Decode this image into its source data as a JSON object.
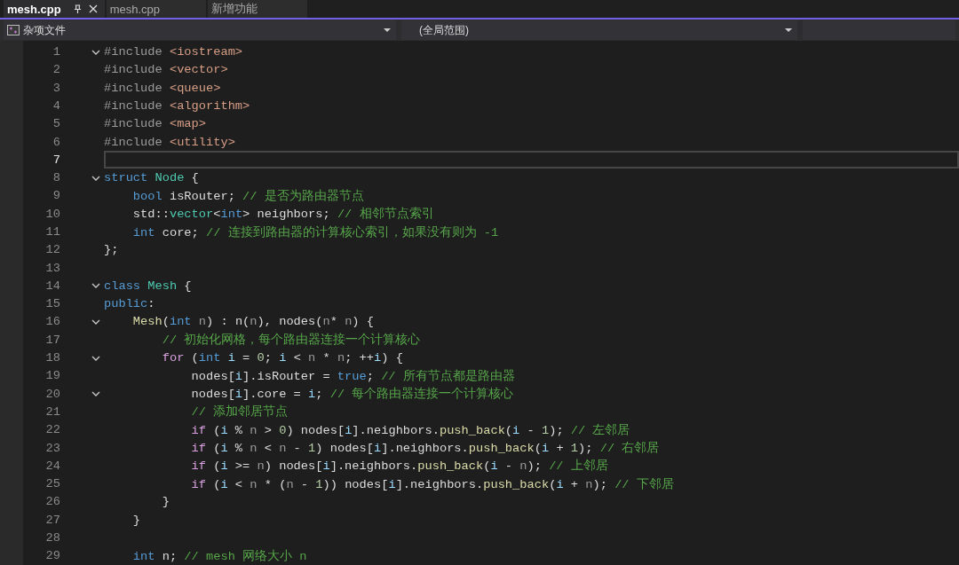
{
  "tabs": [
    {
      "label": "mesh.cpp",
      "selected": true,
      "pinned": true,
      "closable": true
    },
    {
      "label": "mesh.cpp",
      "selected": false,
      "pinned": false,
      "closable": false
    },
    {
      "label": "新增功能",
      "selected": false,
      "pinned": false,
      "closable": false
    }
  ],
  "nav_bar": {
    "project": "杂项文件",
    "scope": "(全局范围)"
  },
  "editor": {
    "lines": [
      {
        "number": "1",
        "fold": true,
        "current": false,
        "tokens": [
          {
            "kind": "pp",
            "text": "#include "
          },
          {
            "kind": "str",
            "text": "<iostream>"
          }
        ]
      },
      {
        "number": "2",
        "fold": false,
        "current": false,
        "tokens": [
          {
            "kind": "pp",
            "text": "#include "
          },
          {
            "kind": "str",
            "text": "<vector>"
          }
        ]
      },
      {
        "number": "3",
        "fold": false,
        "current": false,
        "tokens": [
          {
            "kind": "pp",
            "text": "#include "
          },
          {
            "kind": "str",
            "text": "<queue>"
          }
        ]
      },
      {
        "number": "4",
        "fold": false,
        "current": false,
        "tokens": [
          {
            "kind": "pp",
            "text": "#include "
          },
          {
            "kind": "str",
            "text": "<algorithm>"
          }
        ]
      },
      {
        "number": "5",
        "fold": false,
        "current": false,
        "tokens": [
          {
            "kind": "pp",
            "text": "#include "
          },
          {
            "kind": "str",
            "text": "<map>"
          }
        ]
      },
      {
        "number": "6",
        "fold": false,
        "current": false,
        "tokens": [
          {
            "kind": "pp",
            "text": "#include "
          },
          {
            "kind": "str",
            "text": "<utility>"
          }
        ]
      },
      {
        "number": "7",
        "fold": false,
        "current": true
      },
      {
        "number": "8",
        "fold": true,
        "current": false,
        "tokens": [
          {
            "kind": "kw",
            "text": "struct "
          },
          {
            "kind": "type",
            "text": "Node"
          },
          {
            "kind": "plain",
            "text": " {"
          }
        ]
      },
      {
        "number": "9",
        "fold": false,
        "current": false,
        "tokens": [
          {
            "kind": "kw",
            "text": "    bool"
          },
          {
            "kind": "plain",
            "text": " isRouter; "
          },
          {
            "kind": "cm",
            "text": "// 是否为路由器节点"
          }
        ]
      },
      {
        "number": "10",
        "fold": false,
        "current": false,
        "tokens": [
          {
            "kind": "plain",
            "text": "    std::"
          },
          {
            "kind": "type",
            "text": "vector"
          },
          {
            "kind": "plain",
            "text": "<"
          },
          {
            "kind": "kw",
            "text": "int"
          },
          {
            "kind": "plain",
            "text": "> neighbors; "
          },
          {
            "kind": "cm",
            "text": "// 相邻节点索引"
          }
        ]
      },
      {
        "number": "11",
        "fold": false,
        "current": false,
        "tokens": [
          {
            "kind": "kw",
            "text": "    int"
          },
          {
            "kind": "plain",
            "text": " core; "
          },
          {
            "kind": "cm",
            "text": "// 连接到路由器的计算核心索引，如果没有则为 -1"
          }
        ]
      },
      {
        "number": "12",
        "fold": false,
        "current": false,
        "tokens": [
          {
            "kind": "plain",
            "text": "};"
          }
        ]
      },
      {
        "number": "13",
        "fold": false,
        "current": false
      },
      {
        "number": "14",
        "fold": true,
        "current": false,
        "tokens": [
          {
            "kind": "kw",
            "text": "class "
          },
          {
            "kind": "type",
            "text": "Mesh"
          },
          {
            "kind": "plain",
            "text": " {"
          }
        ]
      },
      {
        "number": "15",
        "fold": false,
        "current": false,
        "tokens": [
          {
            "kind": "kw",
            "text": "public"
          },
          {
            "kind": "plain",
            "text": ":"
          }
        ]
      },
      {
        "number": "16",
        "fold": true,
        "current": false,
        "tokens": [
          {
            "kind": "fn",
            "text": "    Mesh"
          },
          {
            "kind": "plain",
            "text": "("
          },
          {
            "kind": "kw",
            "text": "int"
          },
          {
            "kind": "param",
            "text": " n"
          },
          {
            "kind": "plain",
            "text": ") : n("
          },
          {
            "kind": "param",
            "text": "n"
          },
          {
            "kind": "plain",
            "text": "), nodes("
          },
          {
            "kind": "param",
            "text": "n"
          },
          {
            "kind": "plain",
            "text": "* "
          },
          {
            "kind": "param",
            "text": "n"
          },
          {
            "kind": "plain",
            "text": ") {"
          }
        ]
      },
      {
        "number": "17",
        "fold": false,
        "current": false,
        "tokens": [
          {
            "kind": "cm",
            "text": "        // 初始化网格，每个路由器连接一个计算核心"
          }
        ]
      },
      {
        "number": "18",
        "fold": true,
        "current": false,
        "tokens": [
          {
            "kind": "ctl",
            "text": "        for"
          },
          {
            "kind": "plain",
            "text": " ("
          },
          {
            "kind": "kw",
            "text": "int"
          },
          {
            "kind": "var",
            "text": " i"
          },
          {
            "kind": "plain",
            "text": " = "
          },
          {
            "kind": "num",
            "text": "0"
          },
          {
            "kind": "plain",
            "text": "; "
          },
          {
            "kind": "var",
            "text": "i"
          },
          {
            "kind": "plain",
            "text": " < "
          },
          {
            "kind": "param",
            "text": "n"
          },
          {
            "kind": "plain",
            "text": " * "
          },
          {
            "kind": "param",
            "text": "n"
          },
          {
            "kind": "plain",
            "text": "; ++"
          },
          {
            "kind": "var",
            "text": "i"
          },
          {
            "kind": "plain",
            "text": ") {"
          }
        ]
      },
      {
        "number": "19",
        "fold": false,
        "current": false,
        "tokens": [
          {
            "kind": "plain",
            "text": "            nodes["
          },
          {
            "kind": "var",
            "text": "i"
          },
          {
            "kind": "plain",
            "text": "].isRouter = "
          },
          {
            "kind": "kw",
            "text": "true"
          },
          {
            "kind": "plain",
            "text": "; "
          },
          {
            "kind": "cm",
            "text": "// 所有节点都是路由器"
          }
        ]
      },
      {
        "number": "20",
        "fold": true,
        "current": false,
        "tokens": [
          {
            "kind": "plain",
            "text": "            nodes["
          },
          {
            "kind": "var",
            "text": "i"
          },
          {
            "kind": "plain",
            "text": "].core = "
          },
          {
            "kind": "var",
            "text": "i"
          },
          {
            "kind": "plain",
            "text": "; "
          },
          {
            "kind": "cm",
            "text": "// 每个路由器连接一个计算核心"
          }
        ]
      },
      {
        "number": "21",
        "fold": false,
        "current": false,
        "tokens": [
          {
            "kind": "cm",
            "text": "            // 添加邻居节点"
          }
        ]
      },
      {
        "number": "22",
        "fold": false,
        "current": false,
        "tokens": [
          {
            "kind": "ctl",
            "text": "            if"
          },
          {
            "kind": "plain",
            "text": " ("
          },
          {
            "kind": "var",
            "text": "i"
          },
          {
            "kind": "plain",
            "text": " % "
          },
          {
            "kind": "param",
            "text": "n"
          },
          {
            "kind": "plain",
            "text": " > "
          },
          {
            "kind": "num",
            "text": "0"
          },
          {
            "kind": "plain",
            "text": ") nodes["
          },
          {
            "kind": "var",
            "text": "i"
          },
          {
            "kind": "plain",
            "text": "].neighbors."
          },
          {
            "kind": "fn",
            "text": "push_back"
          },
          {
            "kind": "plain",
            "text": "("
          },
          {
            "kind": "var",
            "text": "i"
          },
          {
            "kind": "plain",
            "text": " - "
          },
          {
            "kind": "num",
            "text": "1"
          },
          {
            "kind": "plain",
            "text": "); "
          },
          {
            "kind": "cm",
            "text": "// 左邻居"
          }
        ]
      },
      {
        "number": "23",
        "fold": false,
        "current": false,
        "tokens": [
          {
            "kind": "ctl",
            "text": "            if"
          },
          {
            "kind": "plain",
            "text": " ("
          },
          {
            "kind": "var",
            "text": "i"
          },
          {
            "kind": "plain",
            "text": " % "
          },
          {
            "kind": "param",
            "text": "n"
          },
          {
            "kind": "plain",
            "text": " < "
          },
          {
            "kind": "param",
            "text": "n"
          },
          {
            "kind": "plain",
            "text": " - "
          },
          {
            "kind": "num",
            "text": "1"
          },
          {
            "kind": "plain",
            "text": ") nodes["
          },
          {
            "kind": "var",
            "text": "i"
          },
          {
            "kind": "plain",
            "text": "].neighbors."
          },
          {
            "kind": "fn",
            "text": "push_back"
          },
          {
            "kind": "plain",
            "text": "("
          },
          {
            "kind": "var",
            "text": "i"
          },
          {
            "kind": "plain",
            "text": " + "
          },
          {
            "kind": "num",
            "text": "1"
          },
          {
            "kind": "plain",
            "text": "); "
          },
          {
            "kind": "cm",
            "text": "// 右邻居"
          }
        ]
      },
      {
        "number": "24",
        "fold": false,
        "current": false,
        "tokens": [
          {
            "kind": "ctl",
            "text": "            if"
          },
          {
            "kind": "plain",
            "text": " ("
          },
          {
            "kind": "var",
            "text": "i"
          },
          {
            "kind": "plain",
            "text": " >= "
          },
          {
            "kind": "param",
            "text": "n"
          },
          {
            "kind": "plain",
            "text": ") nodes["
          },
          {
            "kind": "var",
            "text": "i"
          },
          {
            "kind": "plain",
            "text": "].neighbors."
          },
          {
            "kind": "fn",
            "text": "push_back"
          },
          {
            "kind": "plain",
            "text": "("
          },
          {
            "kind": "var",
            "text": "i"
          },
          {
            "kind": "plain",
            "text": " - "
          },
          {
            "kind": "param",
            "text": "n"
          },
          {
            "kind": "plain",
            "text": "); "
          },
          {
            "kind": "cm",
            "text": "// 上邻居"
          }
        ]
      },
      {
        "number": "25",
        "fold": false,
        "current": false,
        "tokens": [
          {
            "kind": "ctl",
            "text": "            if"
          },
          {
            "kind": "plain",
            "text": " ("
          },
          {
            "kind": "var",
            "text": "i"
          },
          {
            "kind": "plain",
            "text": " < "
          },
          {
            "kind": "param",
            "text": "n"
          },
          {
            "kind": "plain",
            "text": " * ("
          },
          {
            "kind": "param",
            "text": "n"
          },
          {
            "kind": "plain",
            "text": " - "
          },
          {
            "kind": "num",
            "text": "1"
          },
          {
            "kind": "plain",
            "text": ")) nodes["
          },
          {
            "kind": "var",
            "text": "i"
          },
          {
            "kind": "plain",
            "text": "].neighbors."
          },
          {
            "kind": "fn",
            "text": "push_back"
          },
          {
            "kind": "plain",
            "text": "("
          },
          {
            "kind": "var",
            "text": "i"
          },
          {
            "kind": "plain",
            "text": " + "
          },
          {
            "kind": "param",
            "text": "n"
          },
          {
            "kind": "plain",
            "text": "); "
          },
          {
            "kind": "cm",
            "text": "// 下邻居"
          }
        ]
      },
      {
        "number": "26",
        "fold": false,
        "current": false,
        "tokens": [
          {
            "kind": "plain",
            "text": "        }"
          }
        ]
      },
      {
        "number": "27",
        "fold": false,
        "current": false,
        "tokens": [
          {
            "kind": "plain",
            "text": "    }"
          }
        ]
      },
      {
        "number": "28",
        "fold": false,
        "current": false
      },
      {
        "number": "29",
        "fold": false,
        "current": false,
        "tokens": [
          {
            "kind": "kw",
            "text": "    int"
          },
          {
            "kind": "plain",
            "text": " n; "
          },
          {
            "kind": "cm",
            "text": "// mesh 网络大小 n"
          }
        ]
      }
    ]
  }
}
